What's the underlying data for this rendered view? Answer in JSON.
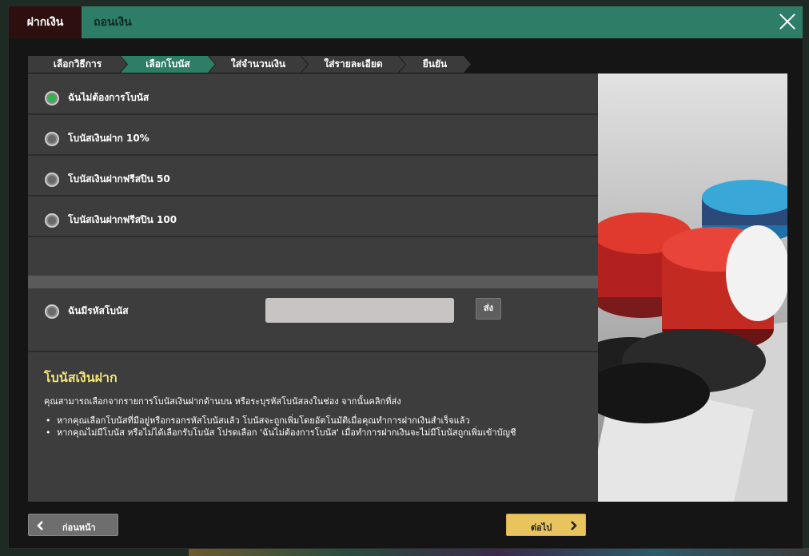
{
  "header": {
    "tabs": [
      {
        "label": "ฝากเงิน",
        "active": true
      },
      {
        "label": "ถอนเงิน",
        "active": false
      }
    ]
  },
  "steps": [
    {
      "label": "เลือกวิธีการ",
      "active": false
    },
    {
      "label": "เลือกโบนัส",
      "active": true
    },
    {
      "label": "ใส่จำนวนเงิน",
      "active": false
    },
    {
      "label": "ใส่รายละเอียด",
      "active": false
    },
    {
      "label": "ยืนยัน",
      "active": false
    }
  ],
  "bonus_options": [
    {
      "label": "ฉันไม่ต้องการโบนัส",
      "selected": true
    },
    {
      "label": "โบนัสเงินฝาก 10%",
      "selected": false
    },
    {
      "label": "โบนัสเงินฝากฟรีสปิน 50",
      "selected": false
    },
    {
      "label": "โบนัสเงินฝากฟรีสปิน 100",
      "selected": false
    }
  ],
  "bonus_code": {
    "label": "ฉันมีรหัสโบนัส",
    "value": "",
    "send_label": "ส่ง"
  },
  "info": {
    "title": "โบนัสเงินฝาก",
    "description": "คุณสามารถเลือกจากรายการโบนัสเงินฝากด้านบน หรือระบุรหัสโบนัสลงในช่อง จากนั้นคลิกที่ส่ง",
    "bullets": [
      "หากคุณเลือกโบนัสที่มีอยู่หรือกรอกรหัสโบนัสแล้ว โบนัสจะถูกเพิ่มโดยอัตโนมัติเมื่อคุณทำการฝากเงินสำเร็จแล้ว",
      "หากคุณไม่มีโบนัส หรือไม่ได้เลือกรับโบนัส โปรดเลือก 'ฉันไม่ต้องการโบนัส' เมื่อทำการฝากเงินจะไม่มีโบนัสถูกเพิ่มเข้าบัญชี"
    ]
  },
  "footer": {
    "back_label": "ก่อนหน้า",
    "next_label": "ต่อไป"
  },
  "colors": {
    "header": "#2e7d66",
    "active_tab": "#2d0f0f",
    "selected_radio": "#27b84e",
    "info_title": "#f2e37a",
    "next_button": "#e8c45f"
  },
  "icons": {
    "close": "close-icon",
    "back": "chevron-left-icon",
    "next": "chevron-right-icon"
  }
}
